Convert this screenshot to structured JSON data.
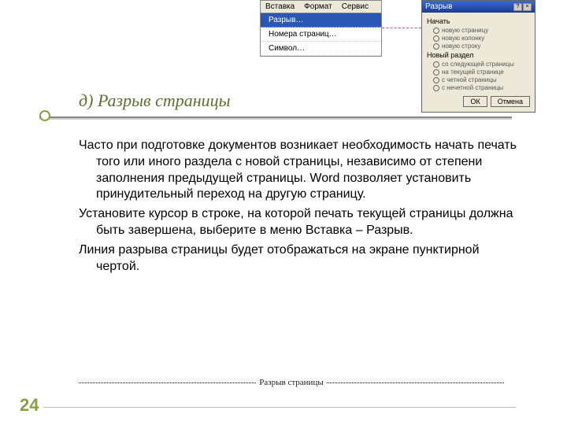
{
  "menu": {
    "bar": [
      "Вставка",
      "Формат",
      "Сервис"
    ],
    "items": [
      {
        "label": "Разрыв…",
        "hl": true
      },
      {
        "label": "Номера страниц…",
        "hl": false
      },
      {
        "label": "Символ…",
        "hl": false
      }
    ]
  },
  "dialog": {
    "title": "Разрыв",
    "group1_label": "Начать",
    "group1_opts": [
      "новую страницу",
      "новую колонку",
      "новую строку"
    ],
    "group2_label": "Новый раздел",
    "group2_opts": [
      "со следующей страницы",
      "на текущей странице",
      "с четной страницы",
      "с нечетной страницы"
    ],
    "ok": "ОК",
    "cancel": "Отмена"
  },
  "slide": {
    "title": "д) Разрыв страницы",
    "p1": "Часто при подготовке документов возникает необходимость начать печать того или иного раздела с новой страницы, независимо от степени заполнения предыдущей страницы. Word позволяет установить принудительный переход на другую страницу.",
    "p2": "Установите курсор в строке, на которой печать текущей страницы должна быть завершена, выберите в меню Вставка – Разрыв.",
    "p3": "Линия разрыва страницы будет отображаться на экране пунктирной чертой.",
    "page_break_label": "Разрыв страницы",
    "page_num": "24"
  }
}
